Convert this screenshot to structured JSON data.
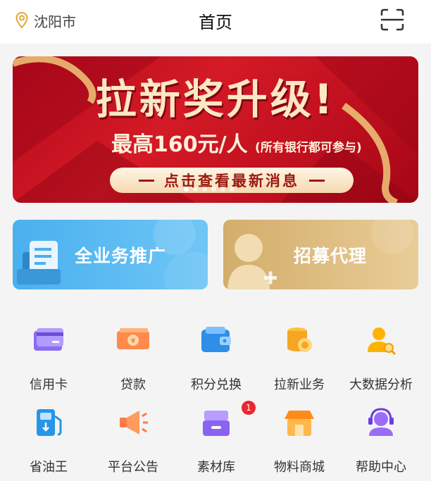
{
  "header": {
    "location": "沈阳市",
    "title": "首页"
  },
  "banner": {
    "headline": "拉新奖升级!",
    "subtitle_main": "最高160元/人",
    "subtitle_note": "(所有银行都可参与)",
    "button_label": "点击查看最新消息",
    "slide_count": 6,
    "active_slide": 1
  },
  "cards": {
    "promote_label": "全业务推广",
    "recruit_label": "招募代理"
  },
  "menu": {
    "items": [
      {
        "label": "信用卡",
        "icon": "credit-card-icon"
      },
      {
        "label": "贷款",
        "icon": "loan-icon"
      },
      {
        "label": "积分兑换",
        "icon": "wallet-icon"
      },
      {
        "label": "拉新业务",
        "icon": "coins-icon"
      },
      {
        "label": "大数据分析",
        "icon": "user-search-icon"
      },
      {
        "label": "省油王",
        "icon": "fuel-pump-icon"
      },
      {
        "label": "平台公告",
        "icon": "megaphone-icon"
      },
      {
        "label": "素材库",
        "icon": "drawer-icon"
      },
      {
        "label": "物料商城",
        "icon": "shop-icon"
      },
      {
        "label": "帮助中心",
        "icon": "headset-icon"
      }
    ],
    "material_badge": "1"
  },
  "colors": {
    "banner_red": "#c0101f",
    "card_blue": "#4ab0ee",
    "card_gold": "#d3ad6b",
    "badge_red": "#e9272d"
  }
}
